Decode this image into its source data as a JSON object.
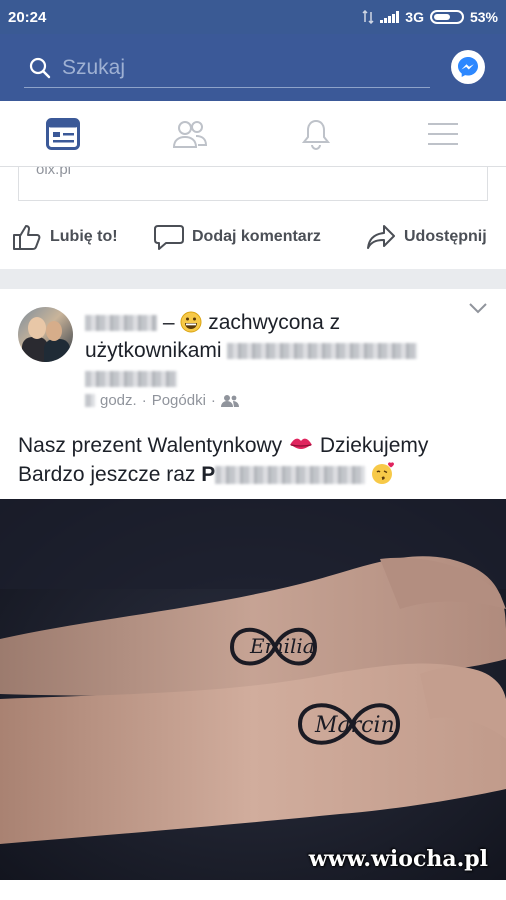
{
  "status_bar": {
    "time": "20:24",
    "network": "3G",
    "battery": "53%"
  },
  "search": {
    "placeholder": "Szukaj"
  },
  "nav_tabs": [
    {
      "name": "news-feed",
      "icon": "news-feed-icon",
      "active": true
    },
    {
      "name": "friends",
      "icon": "friends-icon",
      "active": false
    },
    {
      "name": "notifications",
      "icon": "bell-icon",
      "active": false
    },
    {
      "name": "menu",
      "icon": "hamburger-icon",
      "active": false
    }
  ],
  "previous_post": {
    "link_domain": "olx.pl",
    "actions": {
      "like": "Lubię to!",
      "comment": "Dodaj komentarz",
      "share": "Udostępnij"
    }
  },
  "post": {
    "dash": "–",
    "feeling": "zachwycona z",
    "with_label": "użytkownikami",
    "time_suffix": "godz.",
    "separator": "·",
    "location": "Pogódki",
    "text_line1": "Nasz prezent Walentynkowy",
    "text_line1b": "Dziekujemy",
    "text_line2": "Bardzo jeszcze raz",
    "tattoo_names": [
      "Emilia",
      "Marcin"
    ]
  },
  "watermark": "www.wiocha.pl",
  "colors": {
    "brand": "#3b5998",
    "statusbar": "#3a5a94",
    "divider": "#e9ebee",
    "icon_gray": "#bec2c9"
  }
}
